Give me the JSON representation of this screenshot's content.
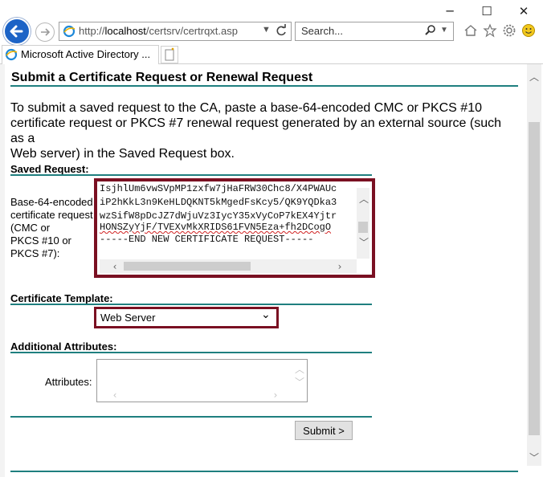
{
  "browser": {
    "url_prefix": "http://",
    "url_host": "localhost",
    "url_path": "/certsrv/certrqxt.asp",
    "search_placeholder": "Search...",
    "tab_title": "Microsoft Active Directory ...",
    "window_controls": {
      "minimize": "─",
      "maximize": "☐",
      "close": "✕"
    }
  },
  "page": {
    "title": "Submit a Certificate Request or Renewal Request",
    "intro_lines": [
      "To submit a saved request to the CA, paste a base-64-encoded CMC or PKCS #10",
      "certificate request or PKCS #7 renewal request generated by an external source (such as a",
      "Web server) in the Saved Request box."
    ],
    "saved_request": {
      "heading": "Saved Request:",
      "label_lines": [
        "Base-64-encoded",
        "certificate request",
        "(CMC or",
        "PKCS #10 or",
        "PKCS #7):"
      ],
      "text_lines": [
        "IsjhlUm6vwSVpMP1zxfw7jHaFRW30Chc8/X4PWAUc",
        "iP2hKkL3n9KeHLDQKNT5kMgedFsKcy5/QK9YQDka3",
        "wzSifW8pDcJZ7dWjuVz3IycY35xVyCoP7kEX4Yjtr",
        "HONSZyYjF/TVEXvMkXRIDS61FVN5Eza+fh2DCogO",
        "-----END NEW CERTIFICATE REQUEST-----"
      ]
    },
    "certificate_template": {
      "heading": "Certificate Template:",
      "selected": "Web Server"
    },
    "additional_attributes": {
      "heading": "Additional Attributes:",
      "label": "Attributes:",
      "value": ""
    },
    "submit_label": "Submit >"
  },
  "colors": {
    "rule": "#1f7f7f",
    "highlight_border": "#7a1022",
    "back_button": "#1c63c6"
  }
}
